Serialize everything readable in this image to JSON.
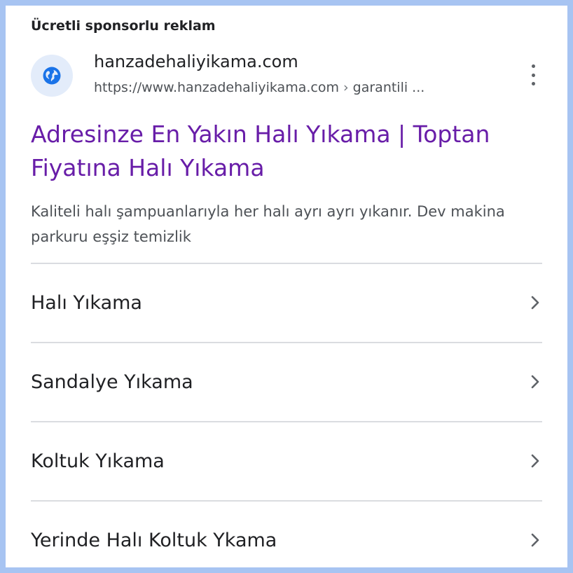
{
  "ad": {
    "sponsored_label": "Ücretli sponsorlu reklam",
    "favicon_icon": "globe-icon",
    "domain": "hanzadehaliyikama.com",
    "url": "https://www.hanzadehaliyikama.com",
    "url_path": "garantili ...",
    "headline": "Adresinze En Yakın Halı Yıkama | Toptan Fiyatına Halı Yıkama",
    "description": "Kaliteli halı şampuanlarıyla her halı ayrı ayrı yıkanır. Dev makina parkuru eşşiz temizlik"
  },
  "sitelinks": [
    {
      "label": "Halı Yıkama"
    },
    {
      "label": "Sandalye Yıkama"
    },
    {
      "label": "Koltuk Yıkama"
    },
    {
      "label": "Yerinde Halı Koltuk Ykama"
    }
  ],
  "colors": {
    "border": "#a7c4f2",
    "headline": "#681da8",
    "favicon_bg": "#e3ecfa",
    "favicon": "#1a73e8",
    "text": "#202124",
    "secondary_text": "#4d5156",
    "divider": "#dadce0"
  }
}
